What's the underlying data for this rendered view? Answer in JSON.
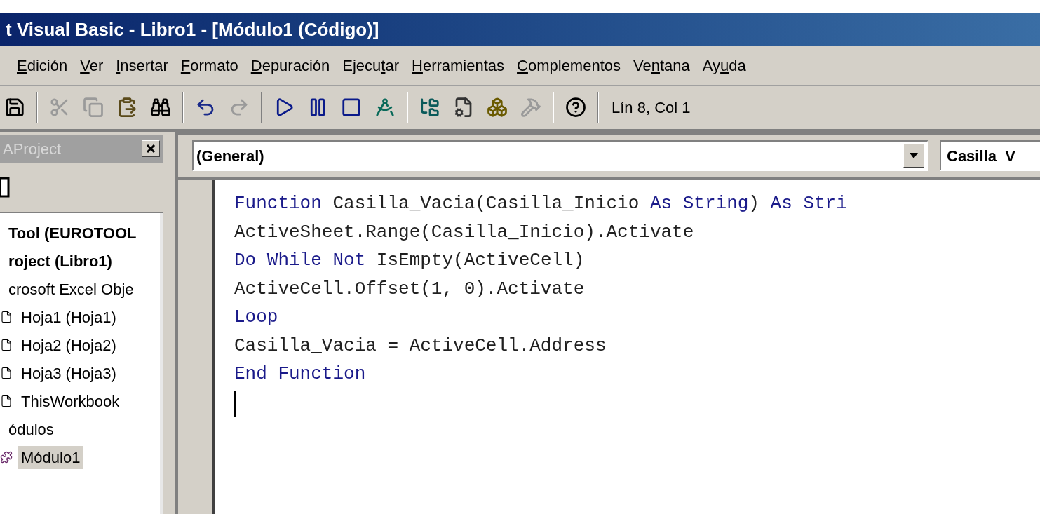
{
  "window": {
    "title": "t Visual Basic - Libro1 - [Módulo1 (Código)]"
  },
  "menu": [
    {
      "key": "E",
      "after": "dición"
    },
    {
      "key": "V",
      "after": "er"
    },
    {
      "key": "I",
      "after": "nsertar"
    },
    {
      "key": "F",
      "after": "ormato"
    },
    {
      "key": "D",
      "after": "epuración"
    },
    {
      "before": "Ejecu",
      "key": "t",
      "after": "ar"
    },
    {
      "key": "H",
      "after": "erramientas"
    },
    {
      "key": "C",
      "after": "omplementos"
    },
    {
      "before": "Ve",
      "key": "n",
      "after": "tana"
    },
    {
      "before": "Ay",
      "key": "u",
      "after": "da"
    }
  ],
  "toolbar": [
    {
      "kind": "save",
      "disabled": false
    },
    {
      "kind": "separator"
    },
    {
      "kind": "cut",
      "disabled": true
    },
    {
      "kind": "copy",
      "disabled": true
    },
    {
      "kind": "paste",
      "disabled": false
    },
    {
      "kind": "find",
      "disabled": false
    },
    {
      "kind": "separator"
    },
    {
      "kind": "undo",
      "disabled": false
    },
    {
      "kind": "redo",
      "disabled": true
    },
    {
      "kind": "separator"
    },
    {
      "kind": "run",
      "disabled": false
    },
    {
      "kind": "pause",
      "disabled": false
    },
    {
      "kind": "stop",
      "disabled": false
    },
    {
      "kind": "design",
      "disabled": false
    },
    {
      "kind": "separator"
    },
    {
      "kind": "explorer",
      "disabled": false
    },
    {
      "kind": "properties",
      "disabled": false
    },
    {
      "kind": "browser",
      "disabled": false
    },
    {
      "kind": "toolbox",
      "disabled": true
    },
    {
      "kind": "separator"
    },
    {
      "kind": "help",
      "disabled": false
    },
    {
      "kind": "separator"
    }
  ],
  "position": "Lín 8, Col 1",
  "project_panel": {
    "title": "AProject",
    "tree": [
      {
        "label": "Tool (EUROTOOL",
        "bold": true,
        "selected": false
      },
      {
        "label": "roject (Libro1)",
        "bold": true,
        "selected": false,
        "children": [
          {
            "label": "crosoft Excel Obje",
            "bold": false,
            "selected": false,
            "children": [
              {
                "label": "Hoja1 (Hoja1)",
                "bold": false,
                "selected": false,
                "kind": "sheet"
              },
              {
                "label": "Hoja2 (Hoja2)",
                "bold": false,
                "selected": false,
                "kind": "sheet"
              },
              {
                "label": "Hoja3 (Hoja3)",
                "bold": false,
                "selected": false,
                "kind": "sheet"
              },
              {
                "label": "ThisWorkbook",
                "bold": false,
                "selected": false,
                "kind": "sheet"
              }
            ]
          },
          {
            "label": "ódulos",
            "bold": false,
            "selected": false,
            "children": [
              {
                "label": "Módulo1",
                "bold": false,
                "selected": true,
                "kind": "module"
              }
            ]
          }
        ]
      }
    ]
  },
  "code_window": {
    "object_dropdown": "(General)",
    "procedure_dropdown": "Casilla_V",
    "lines": [
      [
        {
          "text": "Function ",
          "keyword": true
        },
        {
          "text": "Casilla_Vacia(Casilla_Inicio ",
          "keyword": false
        },
        {
          "text": "As String",
          "keyword": true
        },
        {
          "text": ") ",
          "keyword": false
        },
        {
          "text": "As Stri",
          "keyword": true
        }
      ],
      [
        {
          "text": "ActiveSheet.Range(Casilla_Inicio).Activate",
          "keyword": false
        }
      ],
      [
        {
          "text": "Do While Not ",
          "keyword": true
        },
        {
          "text": "IsEmpty(ActiveCell)",
          "keyword": false
        }
      ],
      [
        {
          "text": "ActiveCell.Offset(1, 0).Activate",
          "keyword": false
        }
      ],
      [
        {
          "text": "Loop",
          "keyword": true
        }
      ],
      [
        {
          "text": "Casilla_Vacia = ActiveCell.Address",
          "keyword": false
        }
      ],
      [
        {
          "text": "End Function",
          "keyword": true
        }
      ]
    ]
  }
}
